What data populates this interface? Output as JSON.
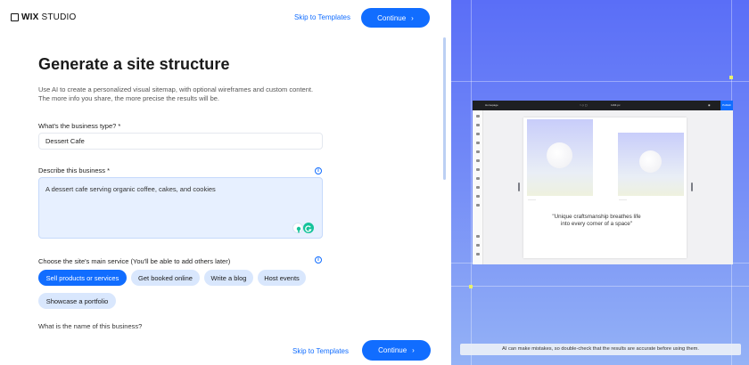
{
  "brand": {
    "logo_bold": "WIX",
    "logo_light": "STUDIO"
  },
  "header": {
    "skip_label": "Skip to Templates",
    "continue_label": "Continue"
  },
  "page": {
    "title": "Generate a site structure",
    "description": "Use AI to create a personalized visual sitemap, with optional wireframes and custom content. The more info you share, the more precise the results will be."
  },
  "form": {
    "business_type": {
      "label": "What's the business type? *",
      "value": "Dessert Cafe"
    },
    "business_description": {
      "label": "Describe this business *",
      "value": "A dessert cafe serving organic coffee, cakes, and cookies"
    },
    "main_service": {
      "label": "Choose the site's main service (You'll be able to add others later)",
      "options": [
        "Sell products or services",
        "Get booked online",
        "Write a blog",
        "Host events",
        "Showcase a portfolio"
      ],
      "selected": "Sell products or services"
    },
    "business_name": {
      "label": "What is the name of this business?",
      "placeholder": ""
    }
  },
  "footer": {
    "skip_label": "Skip to Templates",
    "continue_label": "Continue"
  },
  "preview": {
    "toolbar_page": "Homepage",
    "toolbar_zoom": "1194 px",
    "toolbar_action": "Publish",
    "quote": "\"Unique craftsmanship breathes life into every corner of a space\"",
    "disclaimer": "AI can make mistakes, so double-check that the results are accurate before using them."
  },
  "colors": {
    "accent": "#116dff",
    "chip": "#d9e7fd",
    "panel_gradient_top": "#5a6ef7",
    "panel_gradient_bottom": "#94b2f6"
  }
}
